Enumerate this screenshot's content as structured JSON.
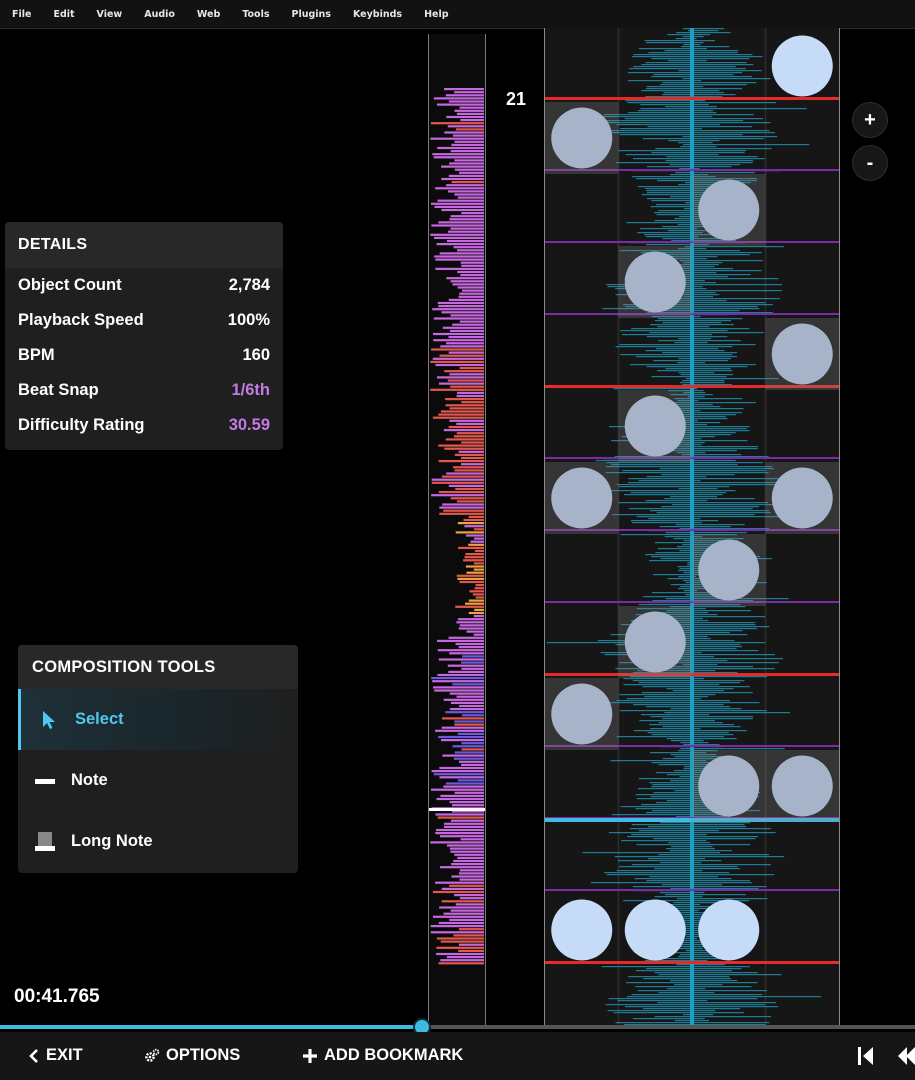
{
  "menu": [
    "File",
    "Edit",
    "View",
    "Audio",
    "Web",
    "Tools",
    "Plugins",
    "Keybinds",
    "Help"
  ],
  "details": {
    "title": "DETAILS",
    "rows": [
      {
        "label": "Object Count",
        "value": "2,784",
        "color": "#ffffff"
      },
      {
        "label": "Playback Speed",
        "value": "100%",
        "color": "#ffffff"
      },
      {
        "label": "BPM",
        "value": "160",
        "color": "#ffffff"
      },
      {
        "label": "Beat Snap",
        "value": "1/6th",
        "color": "#c47ae3"
      },
      {
        "label": "Difficulty Rating",
        "value": "30.59",
        "color": "#c47ae3"
      }
    ]
  },
  "composition_tools": {
    "title": "COMPOSITION TOOLS",
    "items": [
      {
        "label": "Select",
        "icon": "cursor-arrow-icon",
        "active": true
      },
      {
        "label": "Note",
        "icon": "note-bar-icon",
        "active": false
      },
      {
        "label": "Long Note",
        "icon": "long-note-icon",
        "active": false
      }
    ]
  },
  "time": "00:41.765",
  "seek_progress": 0.459,
  "measure_number": "21",
  "zoom": {
    "plus": "+",
    "minus": "-"
  },
  "bottom_bar": {
    "exit": "EXIT",
    "options": "OPTIONS",
    "add_bookmark": "ADD BOOKMARK"
  },
  "colors": {
    "accent": "#3fbbe3",
    "waveform": "#1f8fae",
    "note": "#a7b3c8",
    "note_highlight": "#c6dbf7",
    "measure_line": "#e52a2a",
    "beat_line": "#7c2ba8",
    "selected_line": "#3fbbe3"
  },
  "notes": [
    {
      "lane": 4,
      "beat": 0.0,
      "hl": true
    },
    {
      "lane": 1,
      "beat": 1.0
    },
    {
      "lane": 3,
      "beat": 2.0
    },
    {
      "lane": 2,
      "beat": 3.0
    },
    {
      "lane": 4,
      "beat": 4.0
    },
    {
      "lane": 2,
      "beat": 5.0
    },
    {
      "lane": 1,
      "beat": 6.0
    },
    {
      "lane": 4,
      "beat": 6.0
    },
    {
      "lane": 3,
      "beat": 7.0
    },
    {
      "lane": 2,
      "beat": 8.0
    },
    {
      "lane": 1,
      "beat": 9.0
    },
    {
      "lane": 3,
      "beat": 10.0
    },
    {
      "lane": 4,
      "beat": 10.0
    },
    {
      "lane": 1,
      "beat": 12.0,
      "hl": true
    },
    {
      "lane": 2,
      "beat": 12.0,
      "hl": true
    },
    {
      "lane": 3,
      "beat": 12.0,
      "hl": true
    }
  ]
}
